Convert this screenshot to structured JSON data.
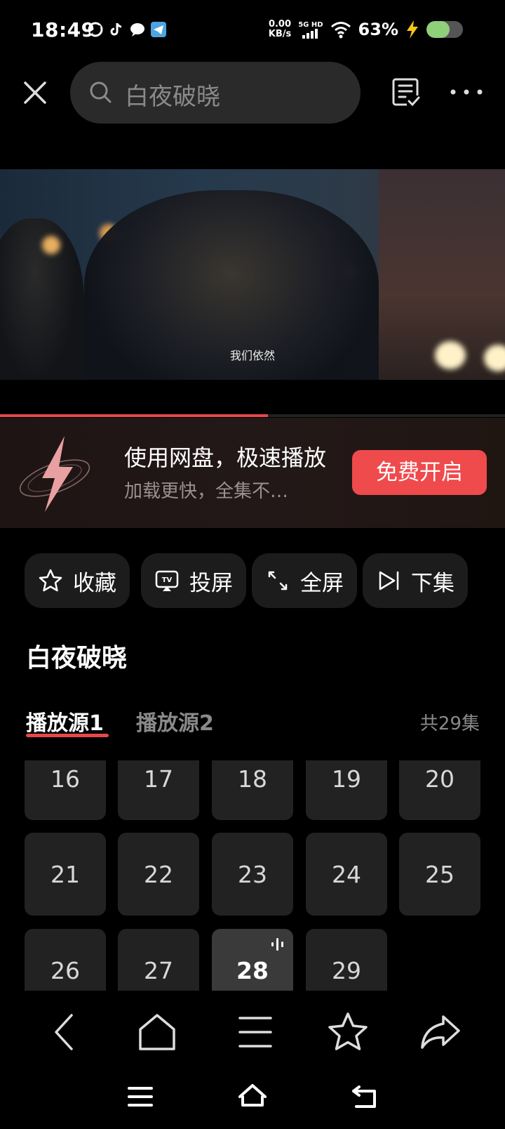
{
  "status_bar": {
    "time": "18:49",
    "net_speed_value": "0.00",
    "net_speed_unit": "KB/s",
    "signal_label": "5G HD",
    "battery_percent": "63%",
    "battery_level": 0.63
  },
  "top_bar": {
    "search_text": "白夜破晓"
  },
  "video": {
    "subtitle": "我们依然",
    "progress": 0.53
  },
  "promo": {
    "title": "使用网盘，极速播放",
    "subtitle": "加载更快，全集不…",
    "button": "免费开启"
  },
  "actions": [
    {
      "label": "收藏",
      "icon": "star-icon"
    },
    {
      "label": "投屏",
      "icon": "cast-icon"
    },
    {
      "label": "全屏",
      "icon": "fullscreen-icon"
    },
    {
      "label": "下集",
      "icon": "next-episode-icon"
    }
  ],
  "show_title": "白夜破晓",
  "tabs": [
    {
      "label": "播放源1",
      "active": true
    },
    {
      "label": "播放源2",
      "active": false
    }
  ],
  "episode_count": "共29集",
  "episodes": [
    "16",
    "17",
    "18",
    "19",
    "20",
    "21",
    "22",
    "23",
    "24",
    "25",
    "26",
    "27",
    "28",
    "29"
  ],
  "current_episode": "28",
  "colors": {
    "accent": "#ef4a4c",
    "background": "#000000",
    "tile": "#222222"
  }
}
